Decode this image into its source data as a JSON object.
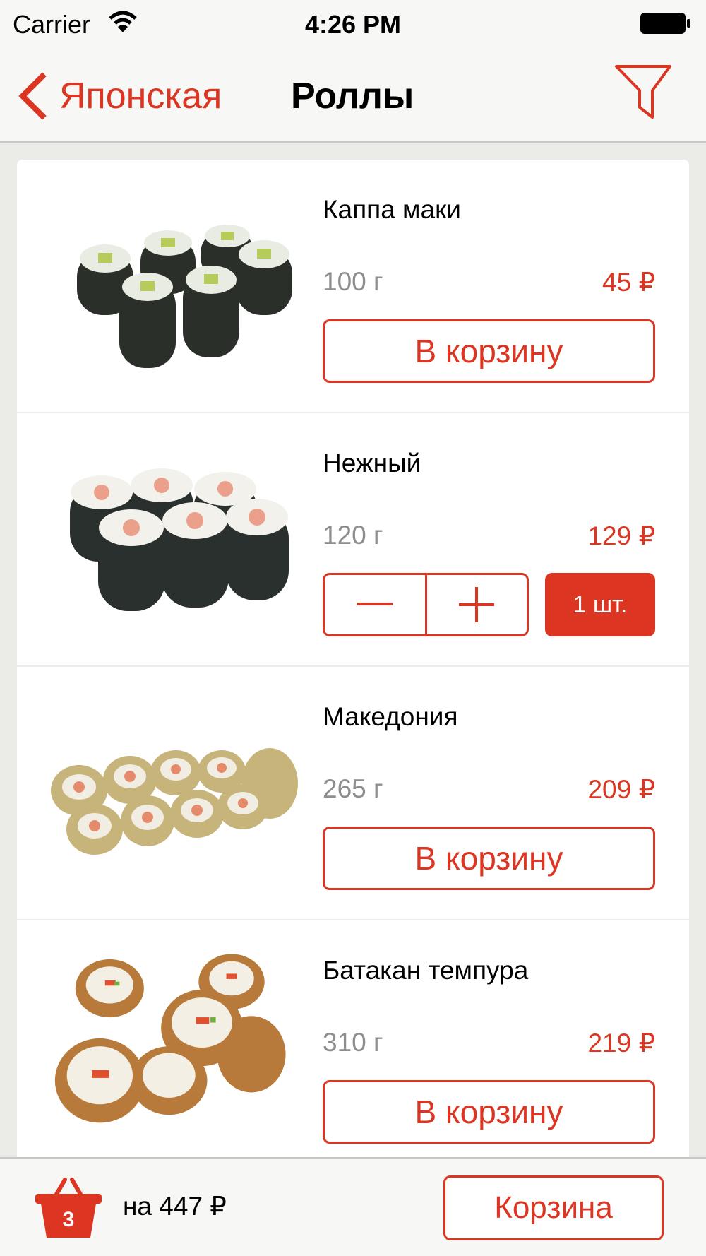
{
  "status_bar": {
    "carrier": "Carrier",
    "time": "4:26 PM"
  },
  "nav": {
    "back_label": "Японская",
    "title": "Роллы"
  },
  "items": [
    {
      "name": "Каппа маки",
      "weight": "100 г",
      "price": "45 ₽",
      "button": "В корзину"
    },
    {
      "name": "Нежный",
      "weight": "120 г",
      "price": "129 ₽",
      "quantity": "1 шт."
    },
    {
      "name": "Македония",
      "weight": "265 г",
      "price": "209 ₽",
      "button": "В корзину"
    },
    {
      "name": "Батакан темпура",
      "weight": "310 г",
      "price": "219 ₽",
      "button": "В корзину"
    }
  ],
  "bottom": {
    "basket_count": "3",
    "total": "на 447 ₽",
    "cart_button": "Корзина"
  },
  "colors": {
    "accent": "#dc3522",
    "muted": "#8e8e8e",
    "background": "#ebebe7",
    "bar": "#f7f7f5"
  },
  "icons": [
    "wifi-icon",
    "battery-icon",
    "chevron-left-icon",
    "filter-icon",
    "minus-icon",
    "plus-icon",
    "basket-icon"
  ]
}
